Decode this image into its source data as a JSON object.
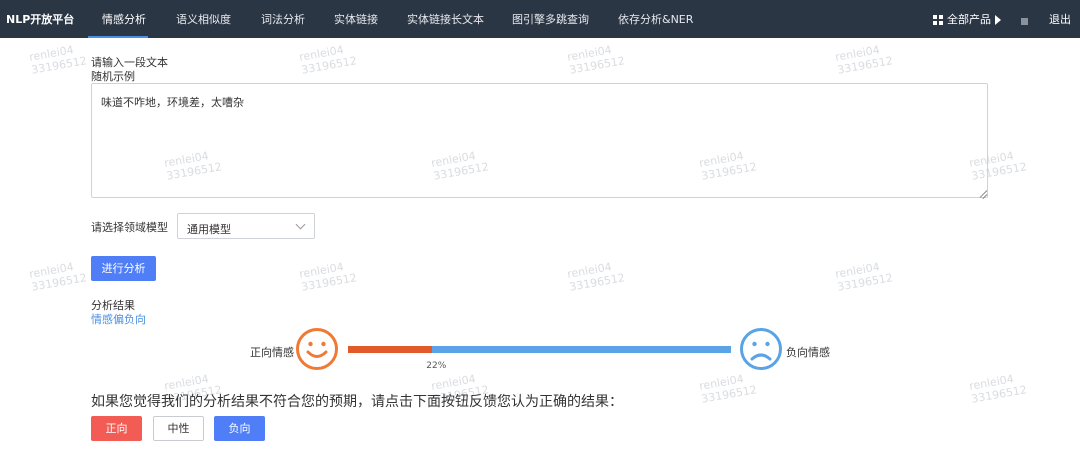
{
  "header": {
    "brand": "NLP开放平台",
    "tabs": [
      {
        "label": "情感分析"
      },
      {
        "label": "语义相似度"
      },
      {
        "label": "词法分析"
      },
      {
        "label": "实体链接"
      },
      {
        "label": "实体链接长文本"
      },
      {
        "label": "图引擎多跳查询"
      },
      {
        "label": "依存分析&NER"
      }
    ],
    "all_products": "全部产品",
    "logout": "退出"
  },
  "form": {
    "prompt": "请输入一段文本",
    "random_example": "随机示例",
    "text_value": "味道不咋地，环境差，太嘈杂",
    "domain_label": "请选择领域模型",
    "model_selected": "通用模型",
    "analyze_button": "进行分析"
  },
  "result": {
    "title": "分析结果",
    "summary": "情感偏负向",
    "positive_label": "正向情感",
    "negative_label": "负向情感",
    "positive_ratio": 0.22,
    "percent_text": "22%",
    "colors": {
      "positive": "#e05a2c",
      "negative": "#5aa3e6"
    }
  },
  "feedback": {
    "prompt": "如果您觉得我们的分析结果不符合您的预期，请点击下面按钮反馈您认为正确的结果：",
    "positive_button": "正向",
    "neutral_button": "中性",
    "negative_button": "负向"
  },
  "watermark": "renlei04\n33196512",
  "icons": {
    "grid": "grid-icon",
    "arrow": "triangle-right-icon",
    "square": "square-icon",
    "happy": "smiley-face-icon",
    "sad": "sad-face-icon",
    "chevron": "chevron-down-icon"
  }
}
